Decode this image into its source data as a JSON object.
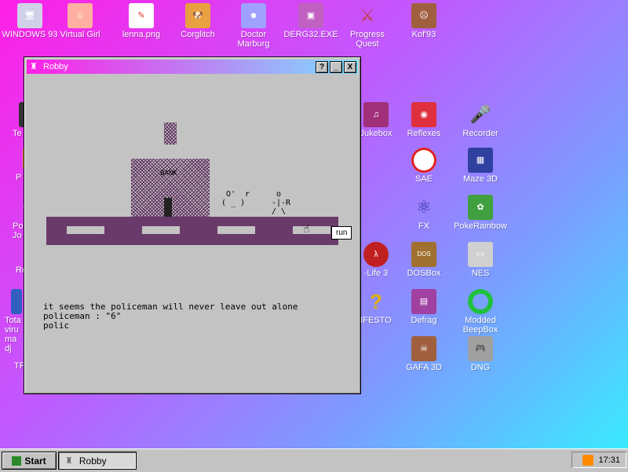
{
  "desktop_icons": [
    {
      "label": "WINDOWS 93",
      "icon": "computer-icon",
      "color": "#3a3a7a"
    },
    {
      "label": "Virtual Girl",
      "icon": "face-icon",
      "color": "#ffb0a0"
    },
    {
      "label": "lenna.png",
      "icon": "paint-icon",
      "color": "#e83030"
    },
    {
      "label": "Corglitch",
      "icon": "corgi-icon",
      "color": "#e8a040"
    },
    {
      "label": "Doctor Marburg",
      "icon": "doctor-icon",
      "color": "#a0a0ff"
    },
    {
      "label": "DERG32.EXE",
      "icon": "derg-icon",
      "color": "#c060c0"
    },
    {
      "label": "Progress Quest",
      "icon": "swords-icon",
      "color": "#c04040"
    },
    {
      "label": "Kof'93",
      "icon": "fighter-icon",
      "color": "#a06040"
    },
    {
      "label": "Jukebox",
      "icon": "jukebox-icon",
      "color": "#a0307a"
    },
    {
      "label": "Reflexes",
      "icon": "lips-icon",
      "color": "#e03040"
    },
    {
      "label": "Recorder",
      "icon": "microphone-icon",
      "color": "#404040"
    },
    {
      "label": "SAE",
      "icon": "ball-icon",
      "color": "#e02020"
    },
    {
      "label": "Maze 3D",
      "icon": "maze-icon",
      "color": "#3040a0"
    },
    {
      "label": "FX",
      "icon": "atom-icon",
      "color": "#3030a0"
    },
    {
      "label": "PokeRainbow",
      "icon": "pokemon-icon",
      "color": "#40a040"
    },
    {
      "label": "-Life 3",
      "icon": "lambda-icon",
      "color": "#c02020"
    },
    {
      "label": "DOSBox",
      "icon": "dosbox-icon",
      "color": "#a07030"
    },
    {
      "label": "NES",
      "icon": "nes-icon",
      "color": "#d0d0d0"
    },
    {
      "label": "IFESTO",
      "icon": "question-icon",
      "color": "#e0b000"
    },
    {
      "label": "Defrag",
      "icon": "defrag-icon",
      "color": "#a040a0"
    },
    {
      "label": "Modded BeepBox",
      "icon": "ring-icon",
      "color": "#20c040"
    },
    {
      "label": "GAFA 3D",
      "icon": "doom-icon",
      "color": "#a06040"
    },
    {
      "label": "DNG",
      "icon": "controller-icon",
      "color": "#a0a0a0"
    }
  ],
  "left_partial_labels": [
    "Te",
    "P",
    "Po Jo",
    "Re",
    "Tota viru ma dj",
    "TF"
  ],
  "window": {
    "title": "Robby",
    "buttons": {
      "help": "?",
      "min": "_",
      "close": "X"
    },
    "bank_label": "BANK",
    "npc_policeman": " O'\n( _ )",
    "npc_r": "r",
    "player": " o\n-|-R\n/ \\",
    "console_lines": [
      "it seems the policeman will never leave out alone",
      "policeman : \"6\"",
      "polic"
    ],
    "tooltip": "run"
  },
  "taskbar": {
    "start_label": "Start",
    "task_label": "Robby",
    "clock": "17:31"
  }
}
